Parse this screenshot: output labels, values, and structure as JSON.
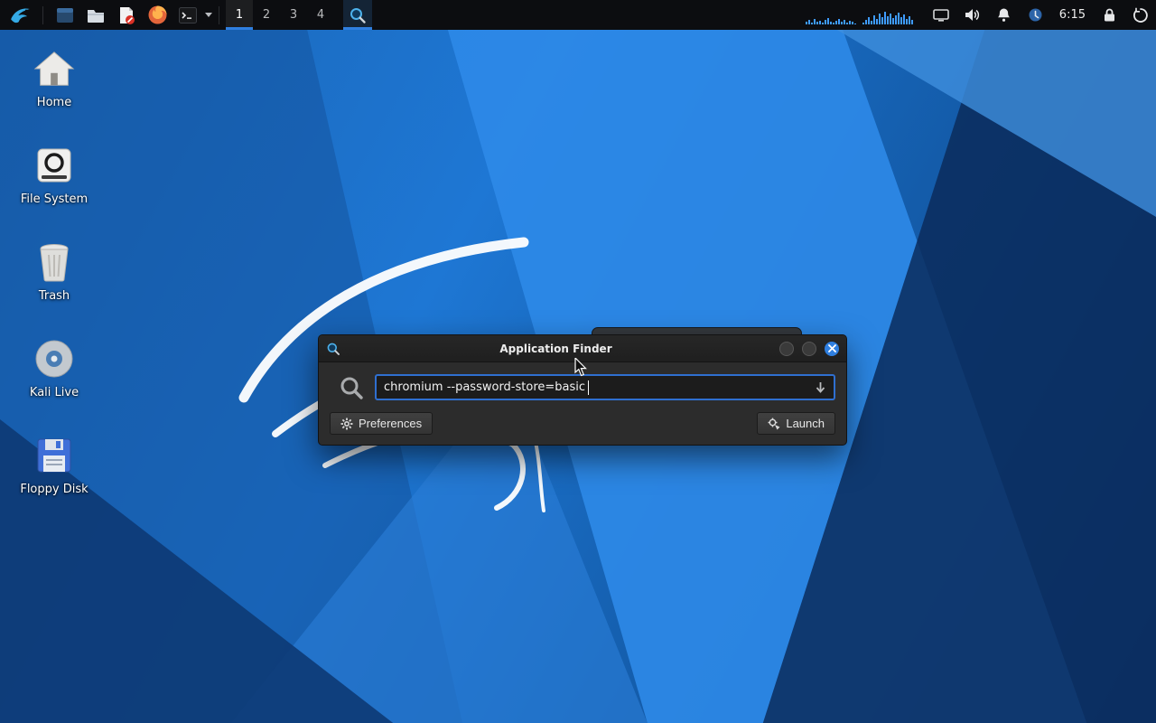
{
  "panel": {
    "launcher_icons": [
      "kali-menu-icon",
      "files-dark-icon",
      "file-manager-icon",
      "text-editor-icon",
      "firefox-icon",
      "terminal-icon"
    ],
    "workspaces": [
      {
        "label": "1",
        "active": true
      },
      {
        "label": "2",
        "active": false
      },
      {
        "label": "3",
        "active": false
      },
      {
        "label": "4",
        "active": false
      }
    ],
    "task_window": "Application Finder",
    "graph_bars": [
      3,
      5,
      2,
      6,
      3,
      4,
      2,
      5,
      7,
      3,
      2,
      4,
      6,
      3,
      5,
      2,
      4,
      3,
      1,
      0,
      0,
      2,
      5,
      8,
      4,
      10,
      6,
      12,
      8,
      14,
      9,
      12,
      7,
      10,
      13,
      8,
      11,
      6,
      9,
      5
    ],
    "tray_icons": [
      "display-icon",
      "volume-icon",
      "notifications-icon",
      "status-icon",
      "lock-icon",
      "logout-icon"
    ],
    "clock": "6:15"
  },
  "desktop": {
    "icons": [
      {
        "label": "Home"
      },
      {
        "label": "File System"
      },
      {
        "label": "Trash"
      },
      {
        "label": "Kali Live"
      },
      {
        "label": "Floppy Disk"
      }
    ]
  },
  "dialog": {
    "title": "Application Finder",
    "input_value": "chromium --password-store=basic",
    "preferences_label": "Preferences",
    "launch_label": "Launch"
  },
  "colors": {
    "accent": "#2f7fe0",
    "graph": "#3e9bff",
    "panel_bg": "#0c0d10"
  }
}
